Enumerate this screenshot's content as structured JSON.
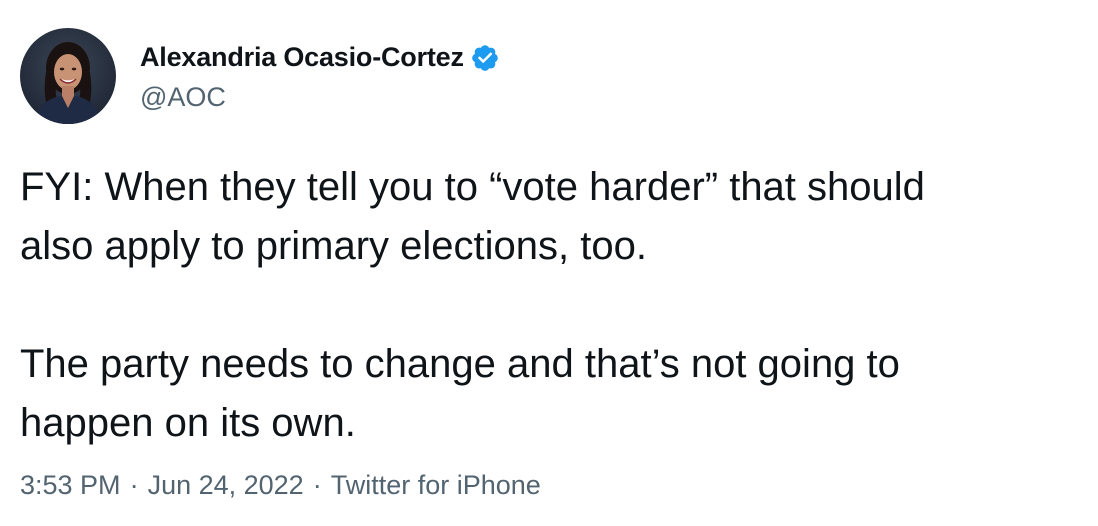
{
  "author": {
    "display_name": "Alexandria Ocasio-Cortez",
    "handle": "@AOC",
    "verified": true,
    "verified_color": "#1d9bf0"
  },
  "tweet": {
    "paragraph_1": "FYI: When they tell you to “vote harder” that should\nalso apply to primary elections, too.",
    "paragraph_2": "The party needs to change and that’s not going to\nhappen on its own."
  },
  "meta": {
    "time": "3:53 PM",
    "separator": "·",
    "date": "Jun 24, 2022",
    "source": "Twitter for iPhone"
  },
  "colors": {
    "text_primary": "#0f1419",
    "text_secondary": "#536471",
    "background": "#ffffff"
  },
  "icons": {
    "avatar": "profile-photo",
    "verified": "verified-badge-icon"
  }
}
